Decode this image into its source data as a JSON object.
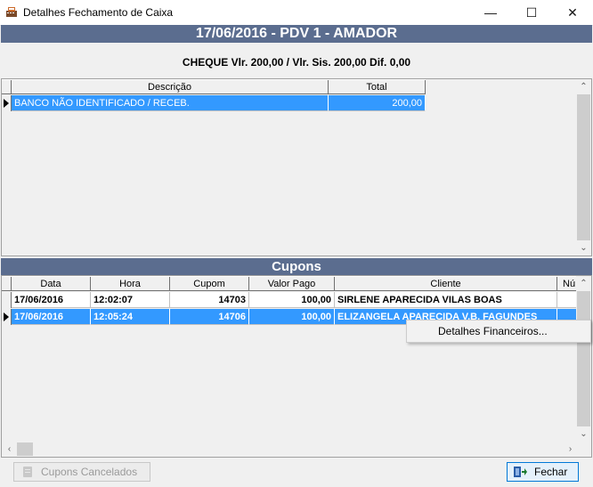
{
  "window": {
    "title": "Detalhes Fechamento de Caixa",
    "minimize_symbol": "—",
    "maximize_symbol": "☐",
    "close_symbol": "✕"
  },
  "header": {
    "title": "17/06/2016 - PDV 1 - AMADOR",
    "summary": "CHEQUE Vlr. 200,00 / Vlr. Sis. 200,00 Dif. 0,00"
  },
  "payments_grid": {
    "columns": [
      "Descrição",
      "Total"
    ],
    "rows": [
      {
        "descricao": "BANCO NÃO IDENTIFICADO / RECEB.",
        "total": "200,00"
      }
    ]
  },
  "cupons": {
    "section_title": "Cupons",
    "columns": [
      "Data",
      "Hora",
      "Cupom",
      "Valor Pago",
      "Cliente",
      "Nú"
    ],
    "rows": [
      {
        "data": "17/06/2016",
        "hora": "12:02:07",
        "cupom": "14703",
        "valor_pago": "100,00",
        "cliente": "SIRLENE APARECIDA VILAS BOAS"
      },
      {
        "data": "17/06/2016",
        "hora": "12:05:24",
        "cupom": "14706",
        "valor_pago": "100,00",
        "cliente": "ELIZANGELA APARECIDA V.B. FAGUNDES"
      }
    ]
  },
  "context_menu": {
    "items": [
      "Detalhes Financeiros..."
    ]
  },
  "footer": {
    "cancelled_button": "Cupons Cancelados",
    "close_button": "Fechar"
  },
  "colors": {
    "header_band": "#5b6d8f",
    "selection": "#3399ff"
  }
}
